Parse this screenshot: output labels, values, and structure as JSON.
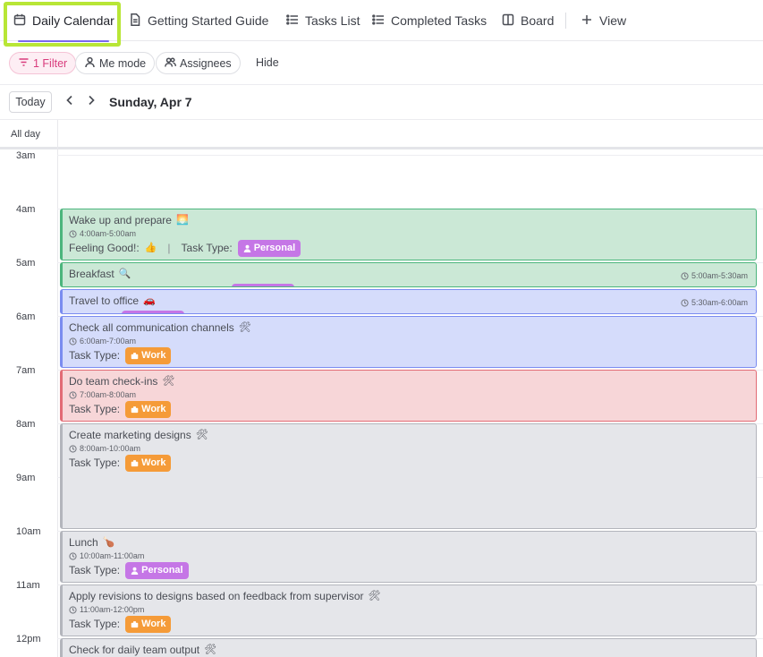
{
  "tabs": [
    {
      "label": "Daily Calendar",
      "icon": "calendar-icon",
      "active": true
    },
    {
      "label": "Getting Started Guide",
      "icon": "document-icon"
    },
    {
      "label": "Tasks List",
      "icon": "list-icon"
    },
    {
      "label": "Completed Tasks",
      "icon": "list-icon"
    },
    {
      "label": "Board",
      "icon": "board-icon"
    },
    {
      "label": "View",
      "icon": "plus-icon"
    }
  ],
  "filters": {
    "filter_label": "1 Filter",
    "me_mode_label": "Me mode",
    "assignees_label": "Assignees",
    "hide_label": "Hide"
  },
  "date_nav": {
    "today_label": "Today",
    "date_title": "Sunday, Apr 7"
  },
  "all_day_label": "All day",
  "hours": [
    "3am",
    "4am",
    "5am",
    "6am",
    "7am",
    "8am",
    "9am",
    "10am",
    "11am",
    "12pm"
  ],
  "events": [
    {
      "title": "Wake up and prepare",
      "emoji": "🌅",
      "time": "4:00am-5:00am",
      "color": "green",
      "feeling_label": "Feeling Good!:",
      "feeling_emoji": "👍",
      "task_type_label": "Task Type:",
      "badge": "Personal"
    },
    {
      "title": "Breakfast",
      "emoji": "🔍",
      "time": "5:00am-5:30am",
      "color": "green"
    },
    {
      "title": "Travel to office",
      "emoji": "🚗",
      "time": "5:30am-6:00am",
      "color": "blue"
    },
    {
      "title": "Check all communication channels",
      "emoji": "🛠",
      "time": "6:00am-7:00am",
      "color": "blue",
      "task_type_label": "Task Type:",
      "badge": "Work"
    },
    {
      "title": "Do team check-ins",
      "emoji": "🛠",
      "time": "7:00am-8:00am",
      "color": "red",
      "task_type_label": "Task Type:",
      "badge": "Work"
    },
    {
      "title": "Create marketing designs",
      "emoji": "🛠",
      "time": "8:00am-10:00am",
      "color": "grey",
      "task_type_label": "Task Type:",
      "badge": "Work"
    },
    {
      "title": "Lunch",
      "emoji": "🍗",
      "time": "10:00am-11:00am",
      "color": "grey",
      "task_type_label": "Task Type:",
      "badge": "Personal"
    },
    {
      "title": "Apply revisions to designs based on feedback from supervisor",
      "emoji": "🛠",
      "time": "11:00am-12:00pm",
      "color": "grey",
      "task_type_label": "Task Type:",
      "badge": "Work"
    },
    {
      "title": "Check for daily team output",
      "emoji": "🛠",
      "color": "grey"
    }
  ],
  "colors": {
    "accent": "#7b68ee",
    "highlight_box": "#b8e636",
    "filter_pink": "#d93b7c",
    "badge_work": "#f59b38",
    "badge_personal": "#c576e6",
    "event_green": "#cbe8d6",
    "event_blue": "#d5dcfb",
    "event_red": "#f7d6d8",
    "event_grey": "#e5e6ea"
  }
}
